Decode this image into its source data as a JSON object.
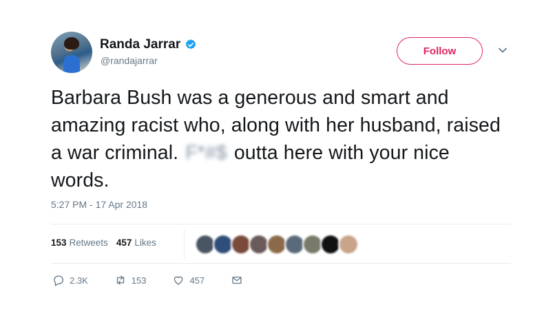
{
  "user": {
    "display_name": "Randa Jarrar",
    "handle": "@randajarrar",
    "verified": true
  },
  "follow_button": {
    "label": "Follow"
  },
  "tweet": {
    "text_before": "Barbara Bush was a generous and smart and amazing racist who, along with her husband, raised a war criminal. ",
    "text_blurred": "F*#$",
    "text_after": " outta here with your nice words.",
    "timestamp": "5:27 PM - 17 Apr 2018"
  },
  "stats": {
    "retweets_count": "153",
    "retweets_label": "Retweets",
    "likes_count": "457",
    "likes_label": "Likes"
  },
  "liker_avatars": [
    "#4a5563",
    "#2f4f7a",
    "#7a4a3a",
    "#6a5a5a",
    "#8b6a4a",
    "#5a6a7a",
    "#7a7a6a",
    "#111111",
    "#c9a48a"
  ],
  "actions": {
    "reply_count": "2.3K",
    "retweet_count": "153",
    "like_count": "457"
  },
  "icons": {
    "verified": "verified-badge-icon",
    "caret": "chevron-down-icon",
    "reply": "reply-icon",
    "retweet": "retweet-icon",
    "like": "heart-icon",
    "message": "envelope-icon"
  },
  "colors": {
    "follow": "#e0245e",
    "verified": "#1da1f2",
    "secondary_text": "#657786",
    "divider": "#e6ecf0"
  }
}
